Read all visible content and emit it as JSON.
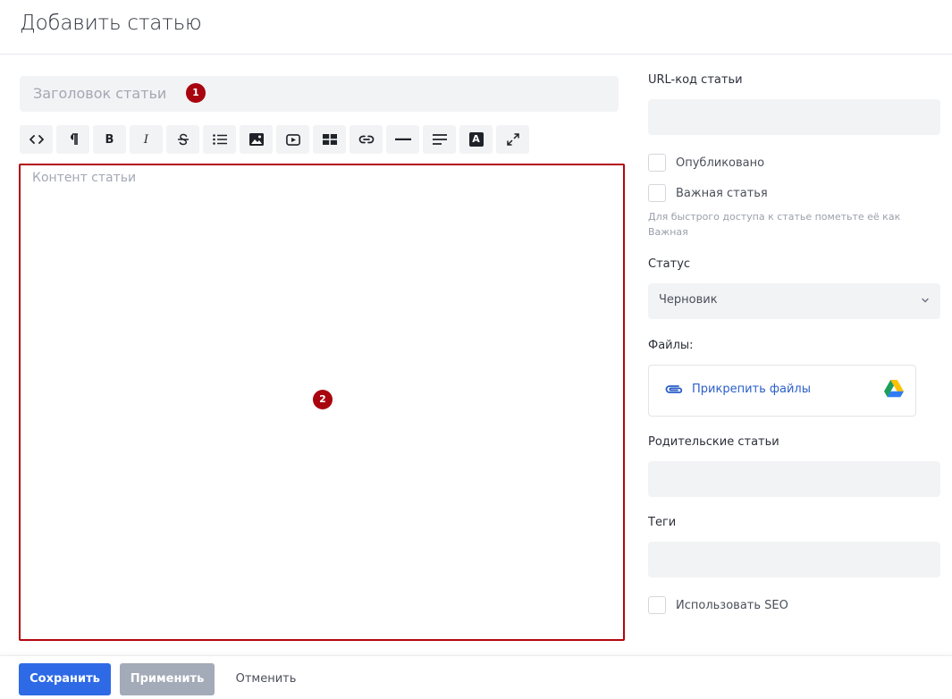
{
  "page": {
    "title": "Добавить статью"
  },
  "editor": {
    "title_placeholder": "Заголовок статьи",
    "content_placeholder": "Контент статьи",
    "toolbar": [
      {
        "icon": "code-icon"
      },
      {
        "icon": "paragraph-icon"
      },
      {
        "icon": "bold-icon",
        "label": "B"
      },
      {
        "icon": "italic-icon",
        "label": "I"
      },
      {
        "icon": "strikethrough-icon"
      },
      {
        "icon": "list-icon"
      },
      {
        "icon": "image-icon"
      },
      {
        "icon": "video-icon"
      },
      {
        "icon": "table-icon"
      },
      {
        "icon": "link-icon"
      },
      {
        "icon": "horizontal-rule-icon"
      },
      {
        "icon": "align-icon"
      },
      {
        "icon": "text-color-icon",
        "label": "A"
      },
      {
        "icon": "fullscreen-icon"
      }
    ]
  },
  "markers": [
    "1",
    "2"
  ],
  "sidebar": {
    "url_label": "URL-код статьи",
    "published_label": "Опубликовано",
    "important_label": "Важная статья",
    "important_hint": "Для быстрого доступа к статье пометьте её как Важная",
    "status_label": "Статус",
    "status_value": "Черновик",
    "files_label": "Файлы:",
    "attach_label": "Прикрепить файлы",
    "parent_label": "Родительские статьи",
    "tags_label": "Теги",
    "seo_label": "Использовать SEO"
  },
  "footer": {
    "save_label": "Сохранить",
    "apply_label": "Применить",
    "cancel_label": "Отменить"
  },
  "colors": {
    "primary": "#2e6ae6",
    "disabled": "#a3aab8",
    "marker": "#a8050f",
    "link": "#2b5fc9"
  }
}
